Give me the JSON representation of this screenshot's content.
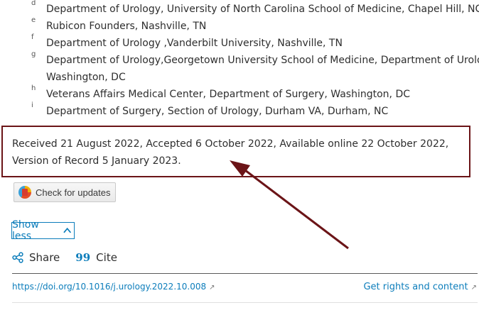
{
  "affiliations": [
    {
      "sup": "d",
      "text": "Department of Urology, University of North Carolina School of Medicine, Chapel Hill, NC"
    },
    {
      "sup": "e",
      "text": "Rubicon Founders, Nashville, TN"
    },
    {
      "sup": "f",
      "text": "Department of Urology ,Vanderbilt University, Nashville, TN"
    },
    {
      "sup": "g",
      "text": "Department of Urology,Georgetown University School of Medicine, Department of Urology,"
    },
    {
      "sup": "",
      "text": "Washington, DC"
    },
    {
      "sup": "h",
      "text": "Veterans Affairs Medical Center, Department of Surgery, Washington, DC"
    },
    {
      "sup": "i",
      "text": "Department of Surgery, Section of Urology, Durham VA, Durham, NC"
    }
  ],
  "dates": {
    "text": "Received 21 August 2022, Accepted 6 October 2022, Available online 22 October 2022, Version of Record 5 January 2023."
  },
  "check_updates": {
    "label": "Check for updates"
  },
  "show_less": {
    "label": "Show less"
  },
  "actions": {
    "share": "Share",
    "cite_icon": "99",
    "cite": "Cite"
  },
  "links": {
    "doi": "https://doi.org/10.1016/j.urology.2022.10.008",
    "rights": "Get rights and content",
    "external_glyph": "↗"
  },
  "colors": {
    "accent": "#0c7dbb",
    "highlight": "#6b1417"
  }
}
